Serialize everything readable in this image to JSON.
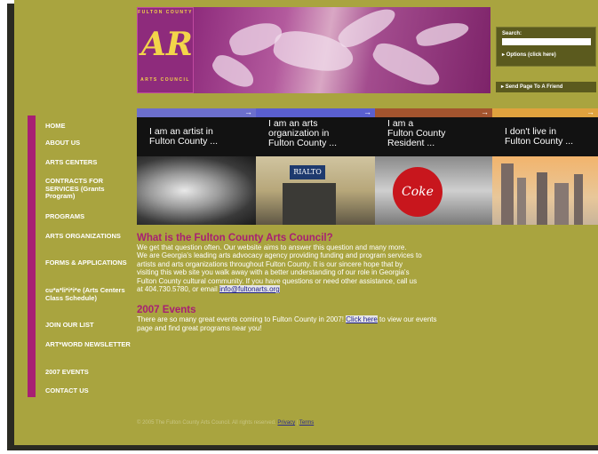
{
  "logo": {
    "top_text": "FULTON COUNTY",
    "mark": "ARTS",
    "bottom_text": "ARTS COUNCIL"
  },
  "search": {
    "label": "Search:",
    "value": "",
    "options_link": "Options (click here)"
  },
  "send_page": "Send Page To A Friend",
  "nav": [
    {
      "label": "HOME"
    },
    {
      "label": "ABOUT US"
    },
    {
      "label": "ARTS CENTERS"
    },
    {
      "label": "CONTRACTS FOR SERVICES (Grants Program)"
    },
    {
      "label": "PROGRAMS"
    },
    {
      "label": "ARTS ORGANIZATIONS"
    },
    {
      "label": "FORMS & APPLICATIONS"
    },
    {
      "label": "cu*a*li*i*i*e (Arts Centers Class Schedule)"
    },
    {
      "label": "JOIN OUR LIST"
    },
    {
      "label": "ART*WORD NEWSLETTER"
    },
    {
      "label": "2007 EVENTS"
    },
    {
      "label": "CONTACT US"
    }
  ],
  "banner": [
    {
      "label_line1": "I am an artist in",
      "label_line2": "Fulton County ...",
      "label_line3": "",
      "color": "#6c6fcc"
    },
    {
      "label_line1": "I am an arts",
      "label_line2": "organization in",
      "label_line3": "Fulton County ...",
      "color": "#5a5fcf"
    },
    {
      "label_line1": "I am a",
      "label_line2": "Fulton County",
      "label_line3": "Resident ...",
      "color": "#a3542e"
    },
    {
      "label_line1": "I don't live in",
      "label_line2": "Fulton County ...",
      "label_line3": "",
      "color": "#e0a23e"
    }
  ],
  "banner_signs": {
    "theatre": "RIALTO",
    "coke": "Coke"
  },
  "about": {
    "heading": "What is the Fulton County Arts Council?",
    "line1": "We get that question often. Our website aims to answer this question and many more.",
    "line2": "We are Georgia's leading arts advocacy agency providing funding and program services to",
    "line3": "artists and arts organizations throughout Fulton County. It is our sincere hope that by",
    "line4": "visiting this web site you walk away with a better understanding of our role in Georgia's",
    "line5": "Fulton County cultural community. If you have questions or need other assistance, call us",
    "line6_prefix": "at 404.730.5780, or email ",
    "email": "info@fultonarts.org"
  },
  "events": {
    "heading": "2007 Events",
    "line1_prefix": "There are so many great events coming to Fulton County in 2007! ",
    "link": "Click here",
    "line1_suffix": " to view our events",
    "line2": "page and find great programs near you!"
  },
  "footer": {
    "text": "© 2005 The Fulton County Arts Council. All rights reserved.",
    "privacy": "Privacy",
    "separator": "|",
    "terms": "Terms"
  },
  "colors": {
    "page_bg": "#a9a43f",
    "accent_magenta": "#a81f73",
    "header_purple": "#8e2b7c",
    "link_blue": "#1a1a8c"
  }
}
